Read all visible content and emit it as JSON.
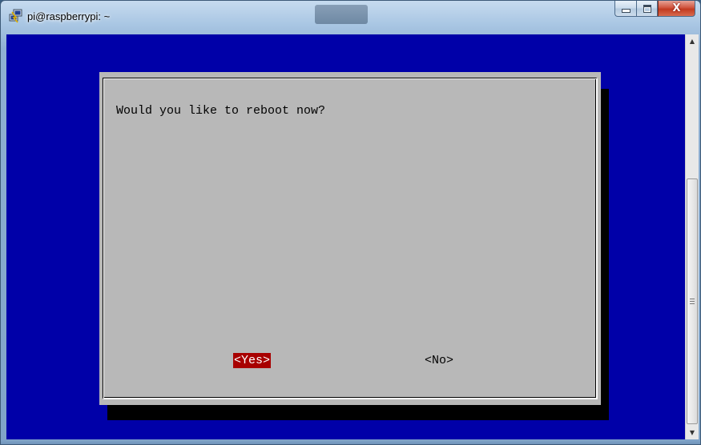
{
  "window": {
    "title": "pi@raspberrypi: ~",
    "icon": "putty-icon",
    "buttons": {
      "minimize": "minimize-icon",
      "maximize": "maximize-icon",
      "close_label": "X"
    }
  },
  "scrollbar": {
    "up_arrow": "▲",
    "down_arrow": "▼"
  },
  "dialog": {
    "message": "Would you like to reboot now?",
    "yes_label": "<Yes>",
    "no_label": "<No>",
    "selected": "yes"
  },
  "colors": {
    "terminal_background": "#0000a8",
    "dialog_background": "#b8b8b8",
    "selected_button_background": "#a80000",
    "selected_button_text": "#ffffff"
  }
}
